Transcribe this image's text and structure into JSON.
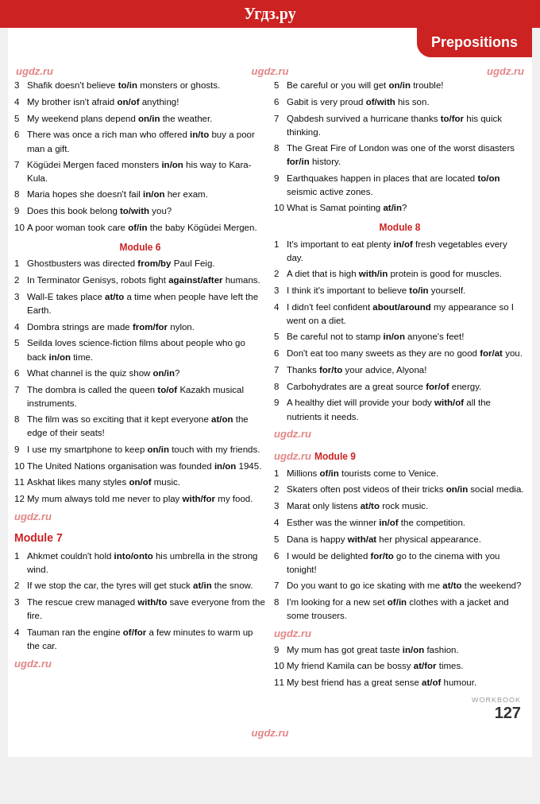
{
  "site": {
    "title": "Угдз.ру"
  },
  "banner": {
    "label": "Prepositions"
  },
  "watermarks": [
    "ugdz.ru",
    "ugdz.ru",
    "ugdz.ru"
  ],
  "columns": {
    "left": {
      "continuation": [
        {
          "num": "3",
          "text": [
            "Shafik doesn't believe ",
            "to/in",
            " monsters or ghosts."
          ]
        },
        {
          "num": "4",
          "text": [
            "My brother isn't afraid ",
            "on/of",
            " anything!"
          ]
        },
        {
          "num": "5",
          "text": [
            "My weekend plans depend ",
            "on/in",
            " the weather."
          ]
        },
        {
          "num": "6",
          "text": [
            "There was once a rich man who offered ",
            "in/to",
            " buy a poor man a gift."
          ]
        },
        {
          "num": "7",
          "text": [
            "Kögüdei Mergen faced monsters ",
            "in/on",
            " his way to Kara-Kula."
          ]
        },
        {
          "num": "8",
          "text": [
            "Maria hopes she doesn't fail ",
            "in/on",
            " her exam."
          ]
        },
        {
          "num": "9",
          "text": [
            "Does this book belong ",
            "to/with",
            " you?"
          ]
        },
        {
          "num": "10",
          "text": [
            "A poor woman took care ",
            "of/in",
            " the baby Kögüdei Mergen."
          ]
        }
      ],
      "module6": {
        "title": "Module 6",
        "entries": [
          {
            "num": "1",
            "text": [
              "Ghostbusters was directed ",
              "from/by",
              " Paul Feig."
            ]
          },
          {
            "num": "2",
            "text": [
              "In Terminator Genisys, robots fight ",
              "against/after",
              " humans."
            ]
          },
          {
            "num": "3",
            "text": [
              "Wall-E takes place ",
              "at/to",
              " a time when people have left the Earth."
            ]
          },
          {
            "num": "4",
            "text": [
              "Dombra strings are made ",
              "from/for",
              " nylon."
            ]
          },
          {
            "num": "5",
            "text": [
              "Seilda loves science-fiction films about people who go back ",
              "in/on",
              " time."
            ]
          },
          {
            "num": "6",
            "text": [
              "What channel is the quiz show ",
              "on/in",
              "?"
            ]
          },
          {
            "num": "7",
            "text": [
              "The dombra is called the queen ",
              "to/of",
              " Kazakh musical instruments."
            ]
          },
          {
            "num": "8",
            "text": [
              "The film was so exciting that it kept everyone ",
              "at/on",
              " the edge of their seats!"
            ]
          },
          {
            "num": "9",
            "text": [
              "I use my smartphone to keep ",
              "on/in",
              " touch with my friends."
            ]
          },
          {
            "num": "10",
            "text": [
              "The United Nations organisation was founded ",
              "in/on",
              " 1945."
            ]
          },
          {
            "num": "11",
            "text": [
              "Askhat likes many styles ",
              "on/of",
              " music."
            ]
          },
          {
            "num": "12",
            "text": [
              "My mum always told me never to play ",
              "with/for",
              " my food."
            ]
          }
        ]
      },
      "module7": {
        "title": "Module 7",
        "entries": [
          {
            "num": "1",
            "text": [
              "Ahkmet couldn't hold ",
              "into/onto",
              " his umbrella in the strong wind."
            ]
          },
          {
            "num": "2",
            "text": [
              "If we stop the car, the tyres will get stuck ",
              "at/in",
              " the snow."
            ]
          },
          {
            "num": "3",
            "text": [
              "The rescue crew managed ",
              "with/to",
              " save everyone from the fire."
            ]
          },
          {
            "num": "4",
            "text": [
              "Tauman ran the engine ",
              "of/for",
              " a few minutes to warm up the car."
            ]
          }
        ]
      }
    },
    "right": {
      "continuation": [
        {
          "num": "5",
          "text": [
            "Be careful or you will get ",
            "on/in",
            " trouble!"
          ]
        },
        {
          "num": "6",
          "text": [
            "Gabit is very proud ",
            "of/with",
            " his son."
          ]
        },
        {
          "num": "7",
          "text": [
            "Qabdesh survived a hurricane thanks ",
            "to/for",
            " his quick thinking."
          ]
        },
        {
          "num": "8",
          "text": [
            "The Great Fire of London was one of the worst disasters ",
            "for/in",
            " history."
          ]
        },
        {
          "num": "9",
          "text": [
            "Earthquakes happen in places that are located ",
            "to/on",
            " seismic active zones."
          ]
        },
        {
          "num": "10",
          "text": [
            "What is Samat pointing ",
            "at/in",
            "?"
          ]
        }
      ],
      "module8": {
        "title": "Module 8",
        "entries": [
          {
            "num": "1",
            "text": [
              "It's important to eat plenty ",
              "in/of",
              " fresh vegetables every day."
            ]
          },
          {
            "num": "2",
            "text": [
              "A diet that is high ",
              "with/in",
              " protein is good for muscles."
            ]
          },
          {
            "num": "3",
            "text": [
              "I think it's important to believe ",
              "to/in",
              " yourself."
            ]
          },
          {
            "num": "4",
            "text": [
              "I didn't feel confident ",
              "about/around",
              " my appearance so I went on a diet."
            ]
          },
          {
            "num": "5",
            "text": [
              "Be careful not to stamp ",
              "in/on",
              " anyone's feet!"
            ]
          },
          {
            "num": "6",
            "text": [
              "Don't eat too many sweets as they are no good ",
              "for/at",
              " you."
            ]
          },
          {
            "num": "7",
            "text": [
              "Thanks ",
              "for/to",
              " your advice, Alyona!"
            ]
          },
          {
            "num": "8",
            "text": [
              "Carbohydrates are a great source ",
              "for/of",
              " energy."
            ]
          },
          {
            "num": "9",
            "text": [
              "A healthy diet will provide your body ",
              "with/of",
              " all the nutrients it needs."
            ]
          }
        ]
      },
      "module9": {
        "title": "Module 9",
        "entries": [
          {
            "num": "1",
            "text": [
              "Millions ",
              "of/in",
              " tourists come to Venice."
            ]
          },
          {
            "num": "2",
            "text": [
              "Skaters often post videos of their tricks ",
              "on/in",
              " social media."
            ]
          },
          {
            "num": "3",
            "text": [
              "Marat only listens ",
              "at/to",
              " rock music."
            ]
          },
          {
            "num": "4",
            "text": [
              "Esther was the winner ",
              "in/of",
              " the competition."
            ]
          },
          {
            "num": "5",
            "text": [
              "Dana is happy ",
              "with/at",
              " her physical appearance."
            ]
          },
          {
            "num": "6",
            "text": [
              "I would be delighted ",
              "for/to",
              " go to the cinema with you tonight!"
            ]
          },
          {
            "num": "7",
            "text": [
              "Do you want to go ice skating with me ",
              "at/to",
              " the weekend?"
            ]
          },
          {
            "num": "8",
            "text": [
              "I'm looking for a new set ",
              "of/in",
              " clothes with a jacket and some trousers."
            ]
          },
          {
            "num": "9",
            "text": [
              "My mum has got great taste ",
              "in/on",
              " fashion."
            ]
          },
          {
            "num": "10",
            "text": [
              "My friend Kamila can be bossy ",
              "at/for",
              " times."
            ]
          },
          {
            "num": "11",
            "text": [
              "My best friend has a great sense ",
              "at/of",
              " humour."
            ]
          }
        ]
      }
    }
  },
  "footer": {
    "workbook": "WORKBOOK",
    "page": "127"
  }
}
